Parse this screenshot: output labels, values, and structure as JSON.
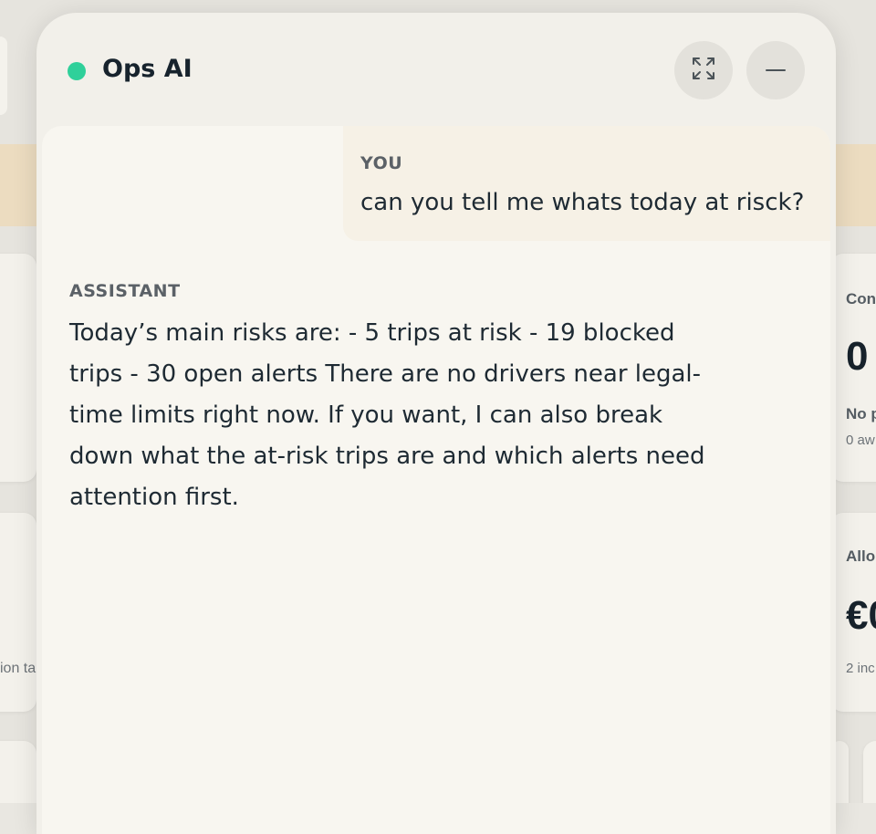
{
  "panel": {
    "title": "Ops AI",
    "status_color": "#2fd09a",
    "expand_icon": "expand-arrows-icon",
    "minimize_icon": "minus-icon"
  },
  "messages": {
    "user": {
      "label": "YOU",
      "text": "can you tell me whats today at risck?"
    },
    "assistant": {
      "label": "ASSISTANT",
      "text": "Today’s main risks are: - 5 trips at risk - 19 blocked trips - 30 open alerts There are no drivers near legal-time limits right now. If you want, I can also break down what the at-risk trips are and which alerts need attention first."
    }
  },
  "background": {
    "card_top_title": "Con",
    "card_top_value": "0",
    "card_top_sub": "No p",
    "card_top_small": "0 aw",
    "card_bottom_title": "Allo",
    "card_bottom_value": "€0",
    "card_bottom_small": "2 inc",
    "left_snippet": "ion ta"
  }
}
